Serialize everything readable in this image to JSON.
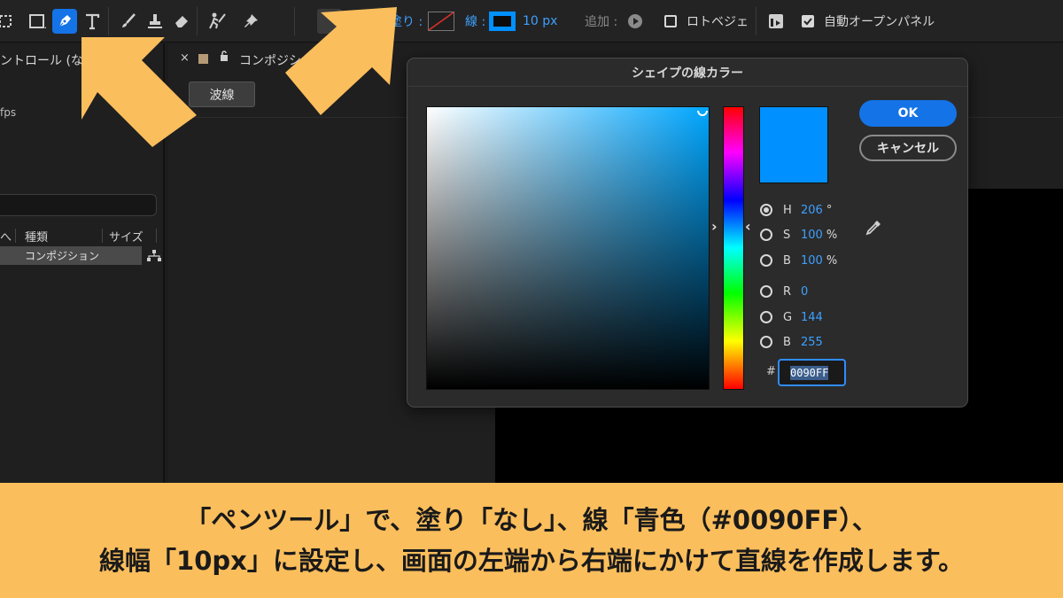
{
  "toolbar": {
    "fill_label": "塗り :",
    "stroke_label": "線 :",
    "stroke_width": "10 px",
    "add_label": "追加 :",
    "rotobezier_label": "ロトベジェ",
    "auto_open_label": "自動オープンパネル"
  },
  "left_panel": {
    "tab_label": "ントロール (な",
    "fps_text": "fps",
    "columns": {
      "type": "種類",
      "size": "サイズ"
    },
    "selected_row": "コンポジション"
  },
  "comp_panel": {
    "close_glyph": "×",
    "tab_label": "コンポジシ",
    "layer_button": "波線"
  },
  "dialog": {
    "title": "シェイプの線カラー",
    "ok_label": "OK",
    "cancel_label": "キャンセル",
    "fields": {
      "h": {
        "label": "H",
        "value": "206",
        "unit": "°"
      },
      "s": {
        "label": "S",
        "value": "100",
        "unit": "%"
      },
      "b": {
        "label": "B",
        "value": "100",
        "unit": "%"
      },
      "r": {
        "label": "R",
        "value": "0"
      },
      "g": {
        "label": "G",
        "value": "144"
      },
      "b2": {
        "label": "B",
        "value": "255"
      }
    },
    "hash": "#",
    "hex_value": "0090FF",
    "selected_color": "#0090FF"
  },
  "caption": {
    "line1": "「ペンツール」で、塗り「なし」、線「青色（#0090FF）、",
    "line2": "線幅「10px」に設定し、画面の左端から右端にかけて直線を作成します。"
  },
  "colors": {
    "accent": "#1473E6",
    "caption_bg": "#FBBE5C",
    "arrow": "#FBBE5C"
  }
}
